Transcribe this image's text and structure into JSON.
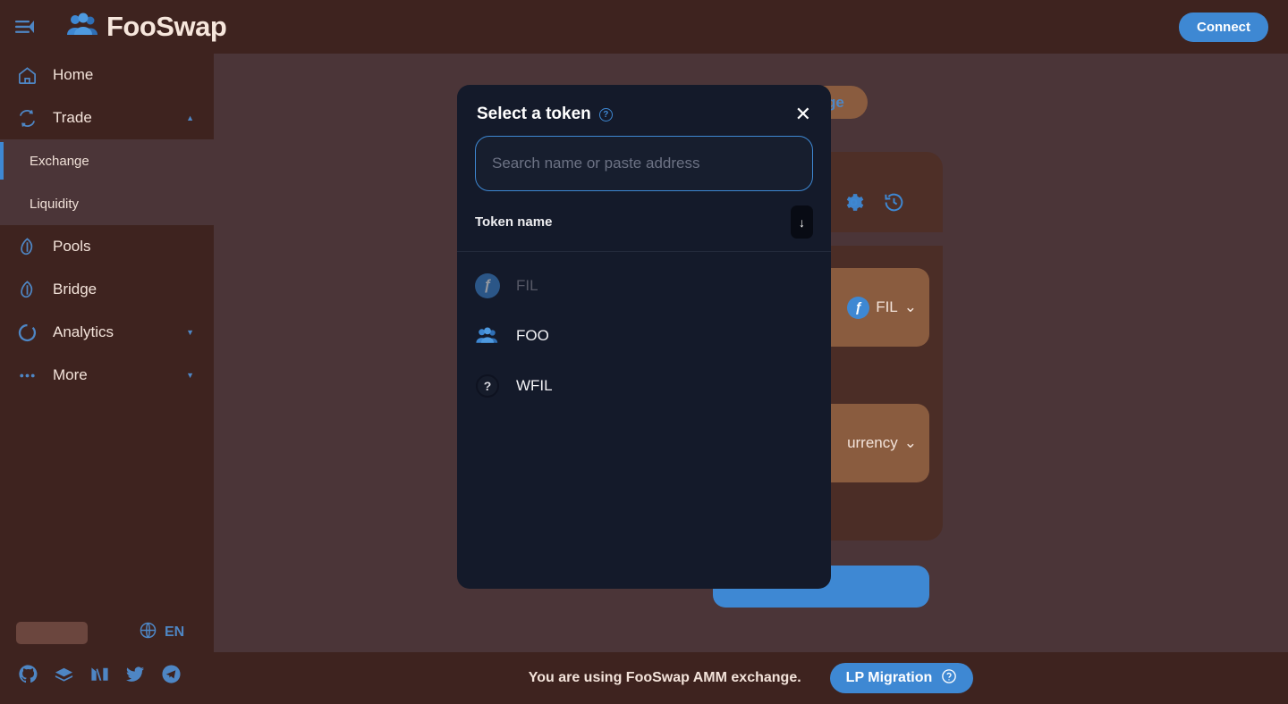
{
  "app": {
    "brand_name": "FooSwap",
    "connect_label": "Connect"
  },
  "topbar": {
    "menu_icon": "collapse-menu-icon",
    "logo_icon": "people-logo-icon"
  },
  "sidebar": {
    "items": [
      {
        "label": "Home",
        "icon": "home-icon",
        "has_caret": false
      },
      {
        "label": "Trade",
        "icon": "swap-arrows-icon",
        "has_caret": true,
        "caret": "▲"
      },
      {
        "label": "Pools",
        "icon": "leaf-icon",
        "has_caret": false
      },
      {
        "label": "Bridge",
        "icon": "leaf-icon",
        "has_caret": false
      },
      {
        "label": "Analytics",
        "icon": "donut-chart-icon",
        "has_caret": true,
        "caret": "▼"
      },
      {
        "label": "More",
        "icon": "ellipsis-icon",
        "has_caret": true,
        "caret": "▼"
      }
    ],
    "submenu": [
      {
        "label": "Exchange",
        "active": true
      },
      {
        "label": "Liquidity",
        "active": false
      }
    ],
    "language": {
      "code": "EN",
      "globe_icon": "globe-icon"
    },
    "social": [
      {
        "name": "github-icon"
      },
      {
        "name": "docs-book-icon"
      },
      {
        "name": "medium-icon"
      },
      {
        "name": "twitter-icon"
      },
      {
        "name": "telegram-icon"
      }
    ]
  },
  "main": {
    "tabs": [
      {
        "label": "Bridge",
        "active": true
      }
    ],
    "card_tools": [
      {
        "name": "settings-gear-icon"
      },
      {
        "name": "transaction-history-icon"
      }
    ],
    "swap_from": {
      "token_symbol": "FIL",
      "chevron": "⌄"
    },
    "swap_to": {
      "token_label": "urrency",
      "chevron": "⌄"
    }
  },
  "footer": {
    "message": "You are using FooSwap AMM exchange.",
    "lp_button_label": "LP Migration",
    "lp_help_icon": "question-circle-icon"
  },
  "modal": {
    "title": "Select a token",
    "help_icon": "question-circle-icon",
    "help_glyph": "?",
    "close_icon": "close-icon",
    "close_glyph": "✕",
    "search": {
      "value": "",
      "placeholder": "Search name or paste address"
    },
    "list_header": {
      "label": "Token name",
      "sort_icon": "sort-descending-icon",
      "sort_glyph": "↓"
    },
    "tokens": [
      {
        "symbol": "FIL",
        "icon": "filecoin-token-icon",
        "glyph": "ƒ",
        "disabled": true
      },
      {
        "symbol": "FOO",
        "icon": "foo-people-token-icon",
        "glyph": "",
        "disabled": false
      },
      {
        "symbol": "WFIL",
        "icon": "unknown-token-icon",
        "glyph": "?",
        "disabled": false
      }
    ]
  },
  "colors": {
    "accent_blue": "#3E88D3",
    "sidebar_brown": "#3E231F",
    "page_brown": "#4B3538",
    "modal_navy": "#141A2A"
  }
}
